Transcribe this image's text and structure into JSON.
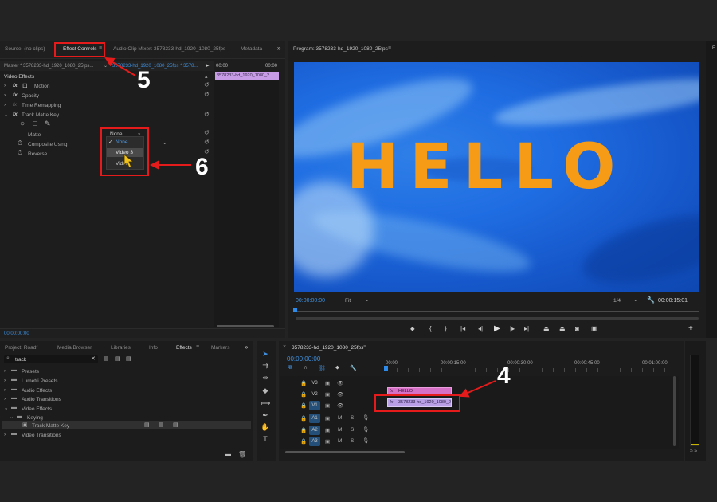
{
  "effect_panel_tabs": {
    "source": "Source: (no clips)",
    "effect_controls": "Effect Controls",
    "audio_clip_mixer": "Audio Clip Mixer: 3578233-hd_1920_1080_25fps",
    "metadata": "Metadata",
    "overflow": "»"
  },
  "effect_controls": {
    "master": "Master * 3578233-hd_1920_1080_25fps...",
    "sequence_clip": "3578233-hd_1920_1080_25fps * 3578...",
    "ruler_left": "00:00",
    "ruler_right": "00:00",
    "clip_bar": "3578233-hd_1920_1080_2",
    "section": "Video Effects",
    "effects": [
      {
        "label": "Motion"
      },
      {
        "label": "Opacity"
      },
      {
        "label": "Time Remapping"
      },
      {
        "label": "Track Matte Key"
      }
    ],
    "matte_label": "Matte",
    "matte_value": "None",
    "composite_label": "Composite Using",
    "reverse_label": "Reverse",
    "dropdown_options": [
      "None",
      "Video 3",
      "Video"
    ],
    "timecode": "00:00:00:00"
  },
  "program": {
    "title": "Program: 3578233-hd_1920_1080_25fps",
    "hello_text": "HELLO",
    "timecode_left": "00:00:00:00",
    "fit": "Fit",
    "resolution": "1/4",
    "timecode_right": "00:00:15:01"
  },
  "project_tabs": {
    "project": "Project: Roadf",
    "media_browser": "Media Browser",
    "libraries": "Libraries",
    "info": "Info",
    "effects": "Effects",
    "markers": "Markers"
  },
  "effects_panel": {
    "search_value": "track",
    "tree": [
      {
        "label": "Presets",
        "indent": 0
      },
      {
        "label": "Lumetri Presets",
        "indent": 0
      },
      {
        "label": "Audio Effects",
        "indent": 0
      },
      {
        "label": "Audio Transitions",
        "indent": 0
      },
      {
        "label": "Video Effects",
        "indent": 0
      },
      {
        "label": "Keying",
        "indent": 1
      },
      {
        "label": "Track Matte Key",
        "indent": 2
      },
      {
        "label": "Video Transitions",
        "indent": 0
      }
    ]
  },
  "timeline": {
    "sequence_name": "3578233-hd_1920_1080_25fps",
    "timecode": "00:00:00:00",
    "ruler": [
      "00:00",
      "00:00:15:00",
      "00:00:30:00",
      "00:00:45:00",
      "00:01:00:00"
    ],
    "video_tracks": [
      "V3",
      "V2",
      "V1"
    ],
    "audio_tracks": [
      "A1",
      "A2",
      "A3"
    ],
    "clip_hello": "HELLO",
    "clip_video": "3578233-hd_1920_1080_2",
    "m_label": "M",
    "s_label": "S",
    "meter_label": "S S"
  },
  "callouts": {
    "five": "5",
    "six": "6",
    "four": "4"
  },
  "colors": {
    "accent_blue": "#2d8ceb",
    "callout_red": "#e51b1b",
    "hello_orange": "#f59b16",
    "clip_pink": "#d66fc6",
    "clip_lavender": "#b9a0e6"
  }
}
